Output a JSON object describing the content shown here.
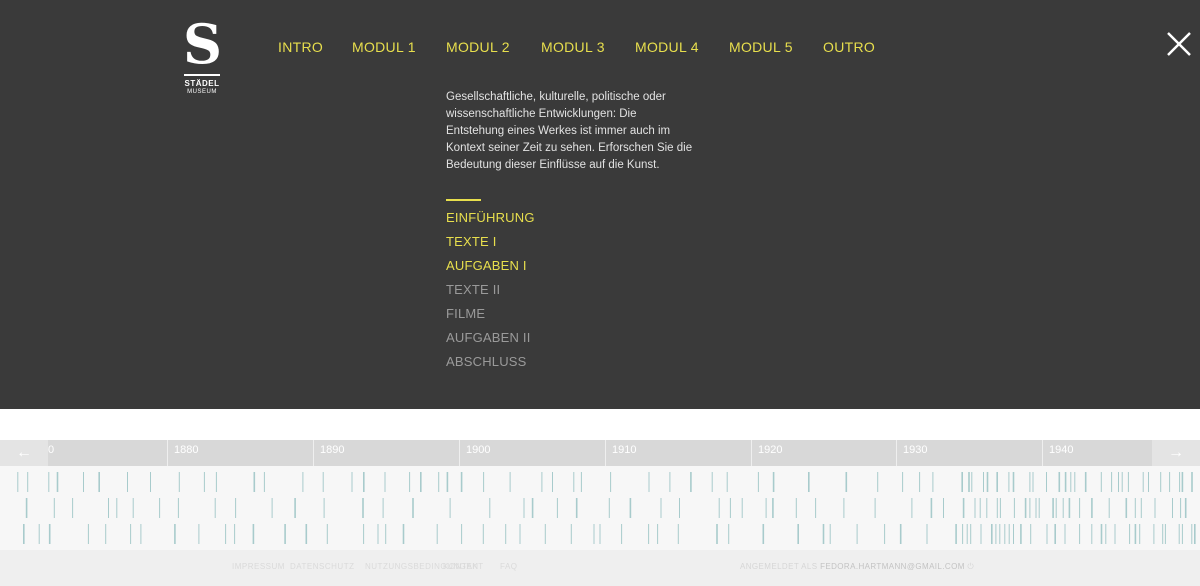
{
  "logo": {
    "letter": "S",
    "line1": "STÄDEL",
    "line2": "MUSEUM"
  },
  "nav": {
    "items": [
      {
        "label": "INTRO"
      },
      {
        "label": "MODUL 1"
      },
      {
        "label": "MODUL 2"
      },
      {
        "label": "MODUL 3"
      },
      {
        "label": "MODUL 4"
      },
      {
        "label": "MODUL 5"
      },
      {
        "label": "OUTRO"
      }
    ]
  },
  "close_icon": "close-icon",
  "module": {
    "description_lines": [
      "Gesellschaftliche, kulturelle, politische oder",
      "wissenschaftliche Entwicklungen: Die",
      "Entstehung eines Werkes ist immer auch im",
      "Kontext seiner Zeit zu sehen. Erforschen Sie die",
      "Bedeutung dieser Einflüsse auf die Kunst."
    ],
    "submenu": [
      {
        "label": "EINFÜHRUNG",
        "state": "active"
      },
      {
        "label": "TEXTE I",
        "state": "active"
      },
      {
        "label": "AUFGABEN I",
        "state": "active"
      },
      {
        "label": "TEXTE II",
        "state": "inactive"
      },
      {
        "label": "FILME",
        "state": "inactive"
      },
      {
        "label": "AUFGABEN II",
        "state": "inactive"
      },
      {
        "label": "ABSCHLUSS",
        "state": "inactive"
      }
    ]
  },
  "timeline": {
    "prev_arrow": "←",
    "next_arrow": "→",
    "decades": [
      "0",
      "1880",
      "1890",
      "1900",
      "1910",
      "1920",
      "1930",
      "1940"
    ]
  },
  "footer": {
    "links": [
      "IMPRESSUM",
      "DATENSCHUTZ",
      "NUTZUNGSBEDINGUNGEN",
      "KONTAKT",
      "FAQ"
    ],
    "login_prefix": "ANGEMELDET ALS",
    "login_email": "FEDORA.HARTMANN@GMAIL.COM"
  },
  "colors": {
    "accent": "#e8df4d",
    "overlay_bg": "#3a3a3a",
    "inactive_text": "#9a9a9a",
    "timeline_tick": "#a8cbcc"
  }
}
